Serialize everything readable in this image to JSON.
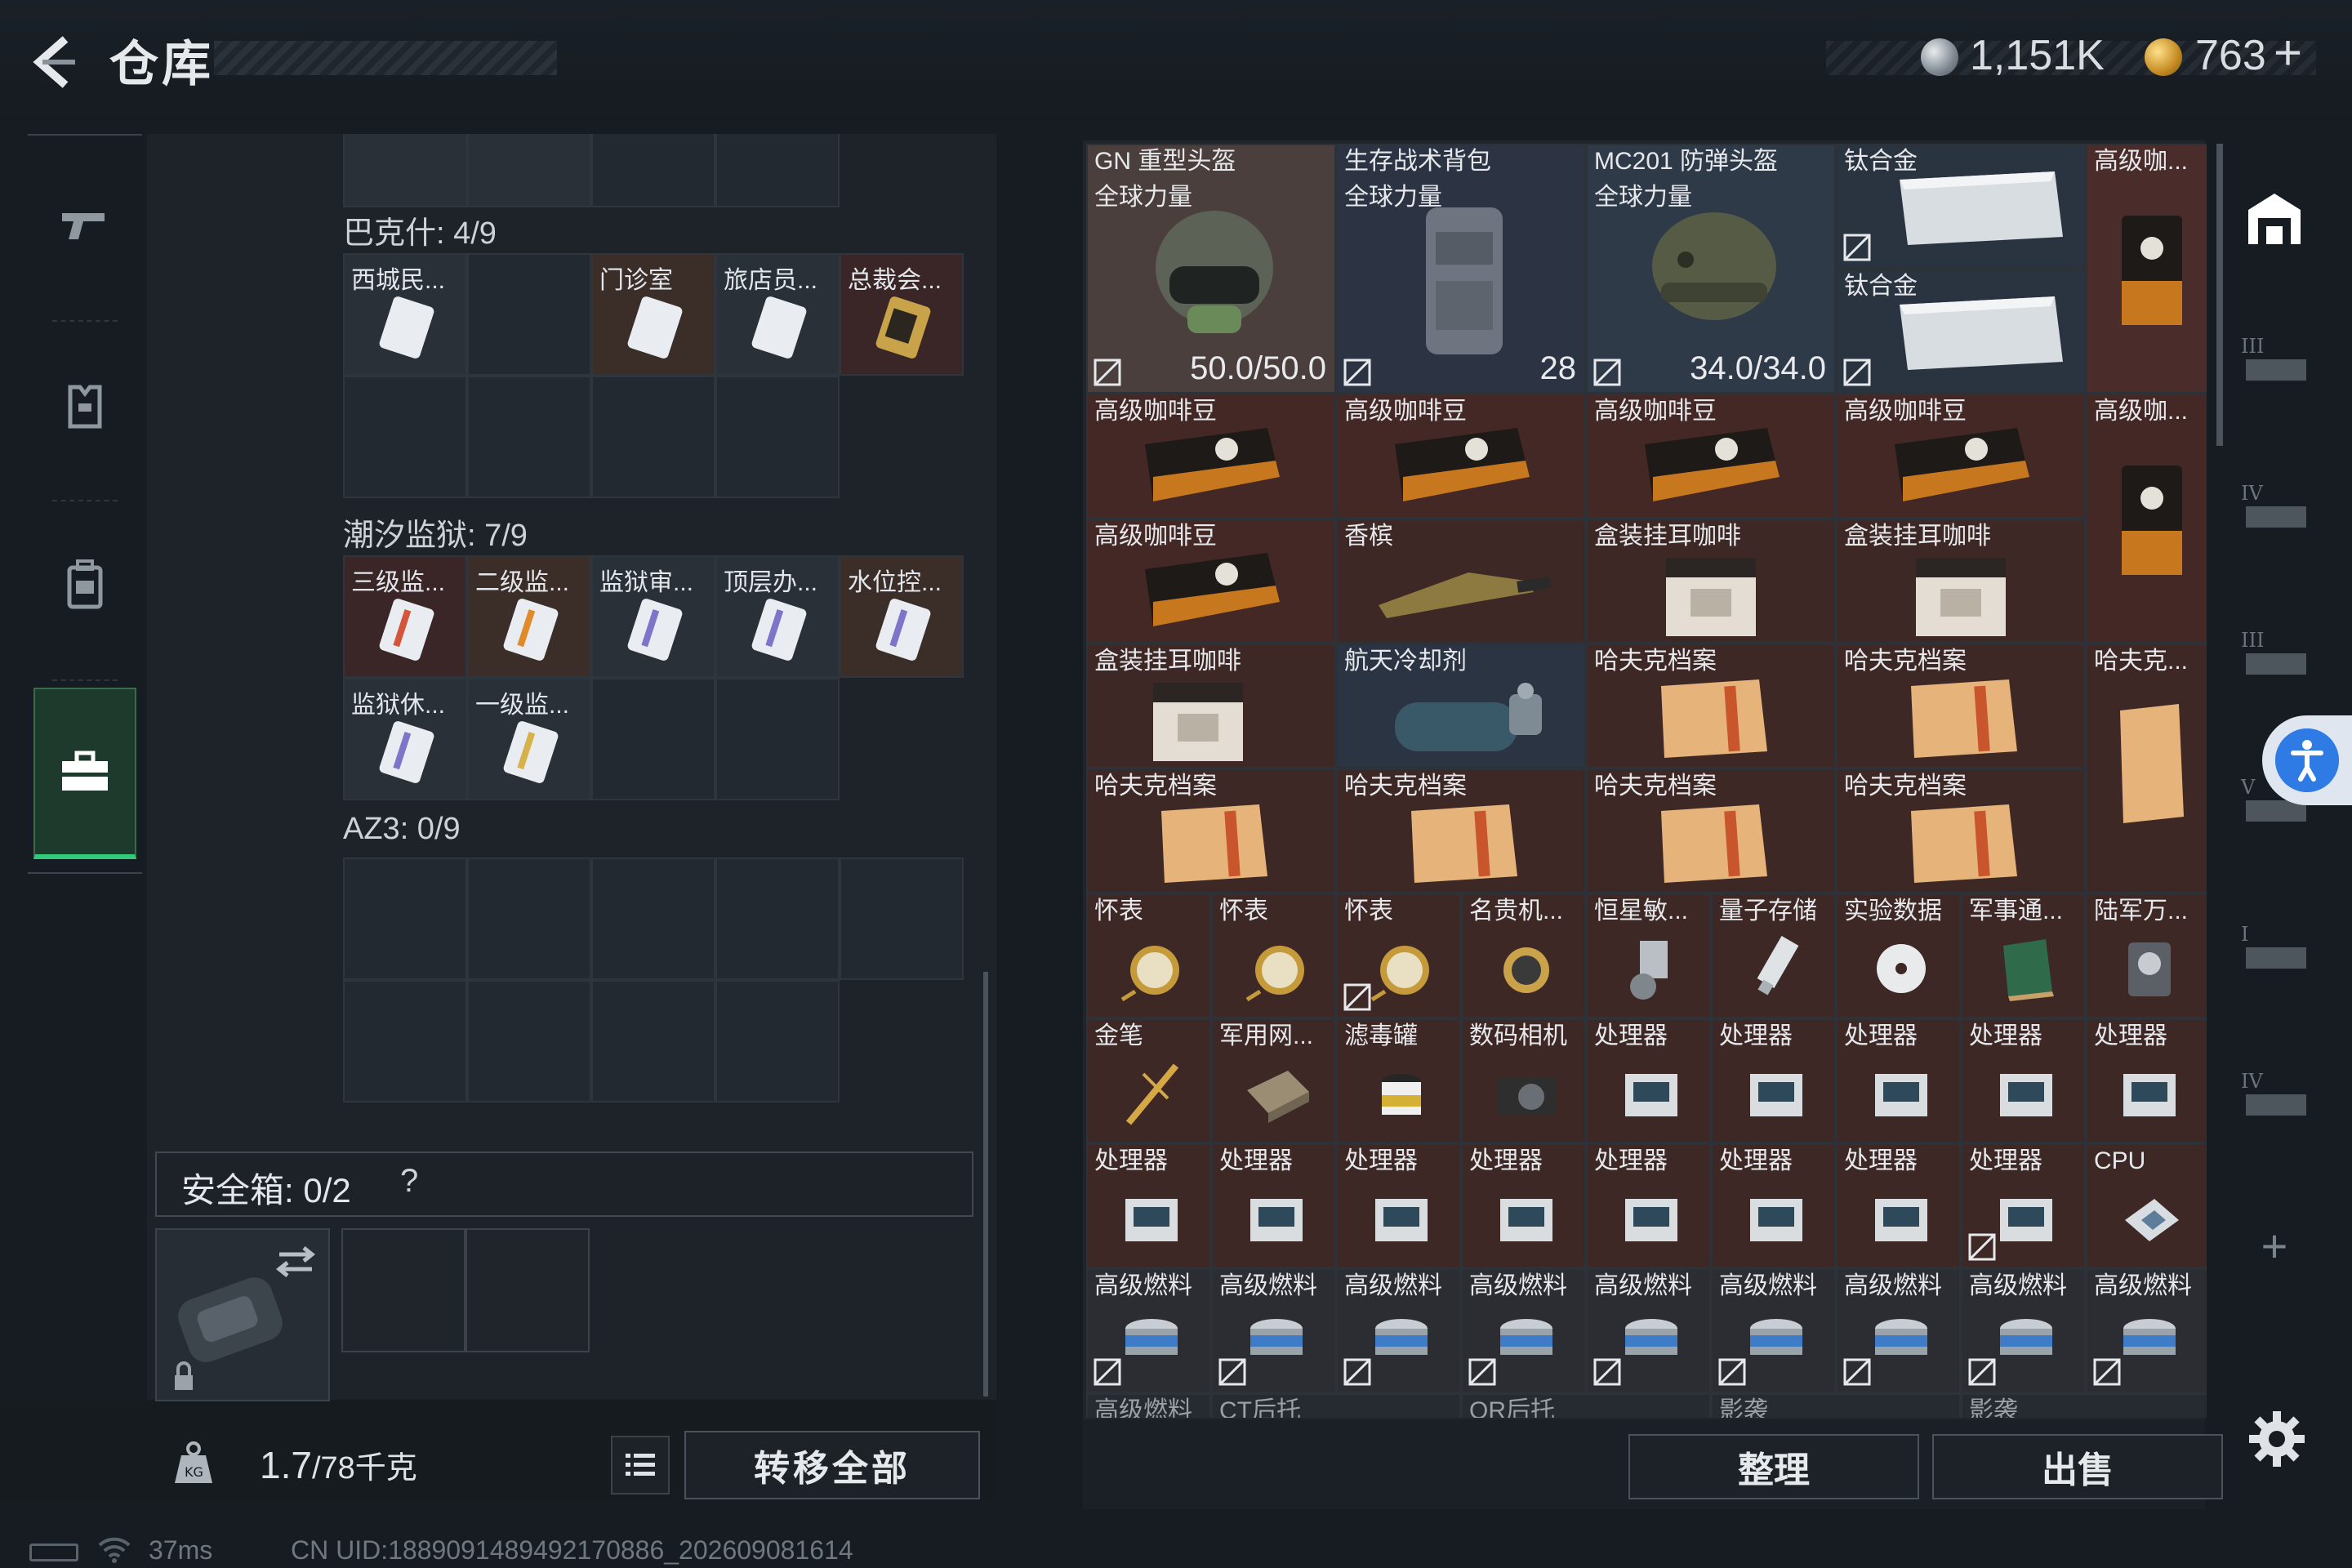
{
  "header": {
    "title": "仓库",
    "currency": {
      "silver_amount": "1,151K",
      "gold_amount": "763",
      "plus": "+"
    }
  },
  "nav": {
    "items": [
      {
        "id": "weapon",
        "icon": "gun-icon"
      },
      {
        "id": "armor",
        "icon": "vest-icon"
      },
      {
        "id": "backpack",
        "icon": "backpack-icon"
      },
      {
        "id": "case",
        "icon": "briefcase-icon",
        "active": true
      }
    ]
  },
  "container": {
    "sections": [
      {
        "title": "巴克什: 4/9",
        "items": [
          "西城民...",
          "",
          "门诊室",
          "旅店员...",
          "总裁会..."
        ]
      },
      {
        "title": "潮汐监狱: 7/9",
        "items": [
          "三级监...",
          "二级监...",
          "监狱审...",
          "顶层办...",
          "水位控...",
          "监狱休...",
          "一级监..."
        ]
      },
      {
        "title": "AZ3: 0/9",
        "items": []
      }
    ],
    "safe_box": {
      "label": "安全箱: 0/2",
      "help": "?"
    },
    "weight": {
      "value": "1.7",
      "max": "/78千克"
    },
    "transfer_all": "转移全部"
  },
  "warehouse": {
    "big": [
      {
        "name": "GN 重型头盔",
        "sub": "全球力量",
        "value": "50.0/50.0"
      },
      {
        "name": "生存战术背包",
        "sub": "全球力量",
        "value": "28"
      },
      {
        "name": "MC201 防弹头盔",
        "sub": "全球力量",
        "value": "34.0/34.0"
      }
    ],
    "titanium": [
      "钛合金",
      "钛合金"
    ],
    "coffee_top": "高级咖...",
    "coffee_mid": "高级咖...",
    "row2": [
      "高级咖啡豆",
      "高级咖啡豆",
      "高级咖啡豆",
      "高级咖啡豆"
    ],
    "row3": [
      "高级咖啡豆",
      "香槟",
      "盒装挂耳咖啡",
      "盒装挂耳咖啡"
    ],
    "row4": [
      "盒装挂耳咖啡",
      "航天冷却剂",
      "哈夫克档案",
      "哈夫克档案",
      "哈夫克..."
    ],
    "row5": [
      "哈夫克档案",
      "哈夫克档案",
      "哈夫克档案",
      "哈夫克档案"
    ],
    "row6": [
      "怀表",
      "怀表",
      "怀表",
      "名贵机...",
      "恒星敏...",
      "量子存储",
      "实验数据",
      "军事通...",
      "陆军万..."
    ],
    "row7": [
      "金笔",
      "军用网...",
      "滤毒罐",
      "数码相机",
      "处理器",
      "处理器",
      "处理器",
      "处理器",
      "处理器"
    ],
    "row8": [
      "处理器",
      "处理器",
      "处理器",
      "处理器",
      "处理器",
      "处理器",
      "处理器",
      "处理器",
      "CPU"
    ],
    "row9": [
      "高级燃料",
      "高级燃料",
      "高级燃料",
      "高级燃料",
      "高级燃料",
      "高级燃料",
      "高级燃料",
      "高级燃料",
      "高级燃料"
    ],
    "row10": [
      "高级燃料",
      "CT后托",
      "",
      "OR后托",
      "",
      "影袭",
      "",
      "影袭",
      ""
    ],
    "sort": "整理",
    "sell": "出售"
  },
  "right_nav": [
    {
      "icon": "warehouse-icon",
      "label": ""
    },
    {
      "icon": "storage-icon",
      "label": "III"
    },
    {
      "icon": "storage-icon",
      "label": "IV"
    },
    {
      "icon": "storage-icon",
      "label": "III"
    },
    {
      "icon": "storage-icon",
      "label": "V"
    },
    {
      "icon": "storage-icon",
      "label": "I"
    },
    {
      "icon": "storage-icon",
      "label": "IV"
    },
    {
      "icon": "plus-icon",
      "label": "+"
    }
  ],
  "status": {
    "ping": "37ms",
    "uid": "CN UID:1889091489492170886_202609081614"
  }
}
